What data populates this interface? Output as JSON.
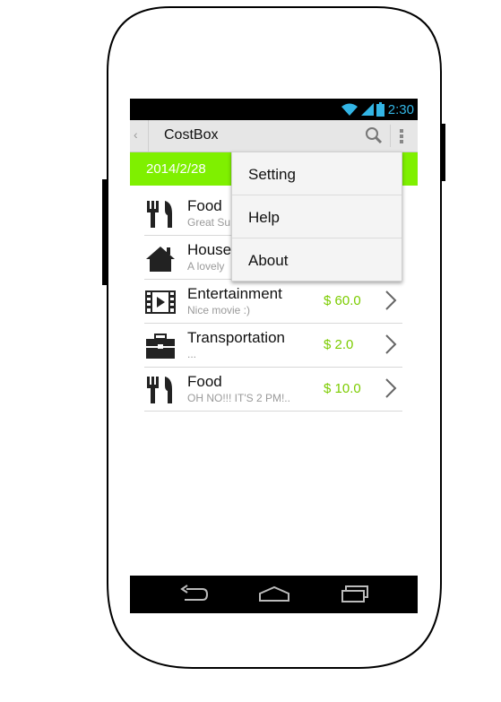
{
  "status": {
    "time": "2:30",
    "accent": "#33b5e5"
  },
  "actionbar": {
    "title": "CostBox",
    "back_icon": "back-chevron-icon",
    "search_icon": "search-icon",
    "overflow_icon": "overflow-menu-icon"
  },
  "datebar": {
    "date": "2014/2/28",
    "color": "#7ff000"
  },
  "items": [
    {
      "category": "Food",
      "note": "Great Su",
      "amount": "",
      "icon": "fork-knife-icon"
    },
    {
      "category": "House",
      "note": "A lovely",
      "amount": "",
      "icon": "house-icon"
    },
    {
      "category": "Entertainment",
      "note": "Nice movie :)",
      "amount": "$ 60.0",
      "icon": "film-icon"
    },
    {
      "category": "Transportation",
      "note": "...",
      "amount": "$ 2.0",
      "icon": "briefcase-icon"
    },
    {
      "category": "Food",
      "note": "OH NO!!! IT'S 2 PM!..",
      "amount": "$ 10.0",
      "icon": "fork-knife-icon"
    }
  ],
  "menu": {
    "items": [
      "Setting",
      "Help",
      "About"
    ]
  },
  "colors": {
    "amount": "#7ccc00"
  }
}
